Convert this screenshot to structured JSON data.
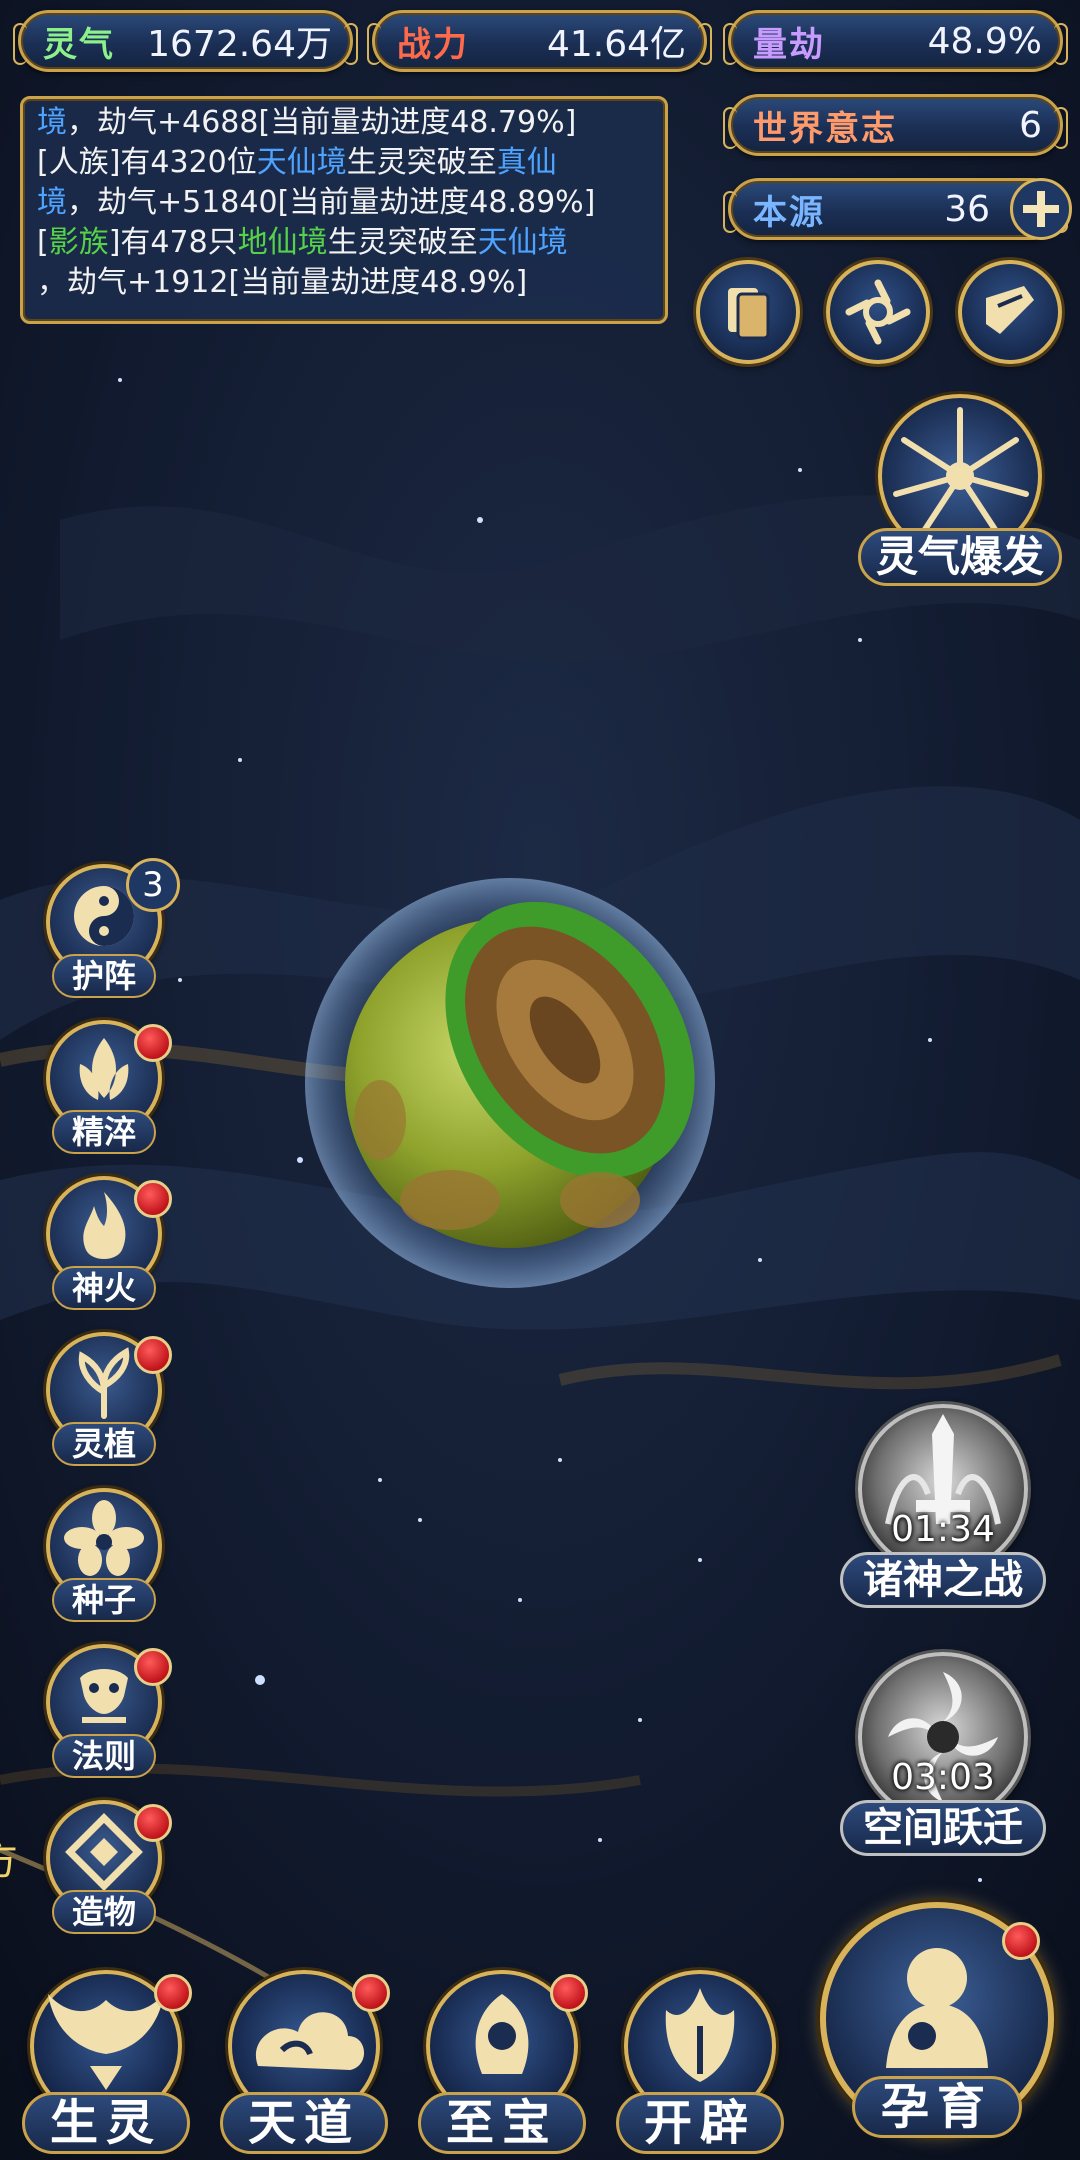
{
  "stats": {
    "spirit": {
      "label": "灵气",
      "value": "1672.64万"
    },
    "power": {
      "label": "战力",
      "value": "41.64亿"
    },
    "calamity": {
      "label": "量劫",
      "value": "48.9%"
    },
    "world_will": {
      "label": "世界意志",
      "value": "6"
    },
    "origin": {
      "label": "本源",
      "value": "36"
    }
  },
  "log": {
    "l1a": "境",
    "l1b": "，劫气+4688[当前量劫进度48.79%]",
    "l2a": "[人族]有4320位",
    "l2b": "天仙境",
    "l2c": "生灵突破至",
    "l2d": "真仙",
    "l3a": "境",
    "l3b": "，劫气+51840[当前量劫进度48.89%]",
    "l4a": "[",
    "l4b": "影族",
    "l4c": "]有478只",
    "l4d": "地仙境",
    "l4e": "生灵突破至",
    "l4f": "天仙境",
    "l5": "，劫气+1912[当前量劫进度48.9%]"
  },
  "burst": {
    "label": "灵气爆发"
  },
  "side": {
    "formation": {
      "label": "护阵",
      "badge": "3"
    },
    "refine": {
      "label": "精淬"
    },
    "fire": {
      "label": "神火"
    },
    "plant": {
      "label": "灵植"
    },
    "seed": {
      "label": "种子"
    },
    "law": {
      "label": "法则"
    },
    "create": {
      "label": "造物"
    }
  },
  "events": {
    "war": {
      "label": "诸神之战",
      "time": "01:34"
    },
    "jump": {
      "label": "空间跃迁",
      "time": "03:03"
    }
  },
  "nav": {
    "life": "生灵",
    "dao": "天道",
    "treasure": "至宝",
    "open": "开辟",
    "nurture": "孕育"
  },
  "colors": {
    "gold": "#d8b35a",
    "panel": "#1b2f55",
    "highlight_blue": "#4ea3ff",
    "highlight_green": "#55d24a",
    "notify_red": "#c0141b"
  },
  "edge_text": "方"
}
